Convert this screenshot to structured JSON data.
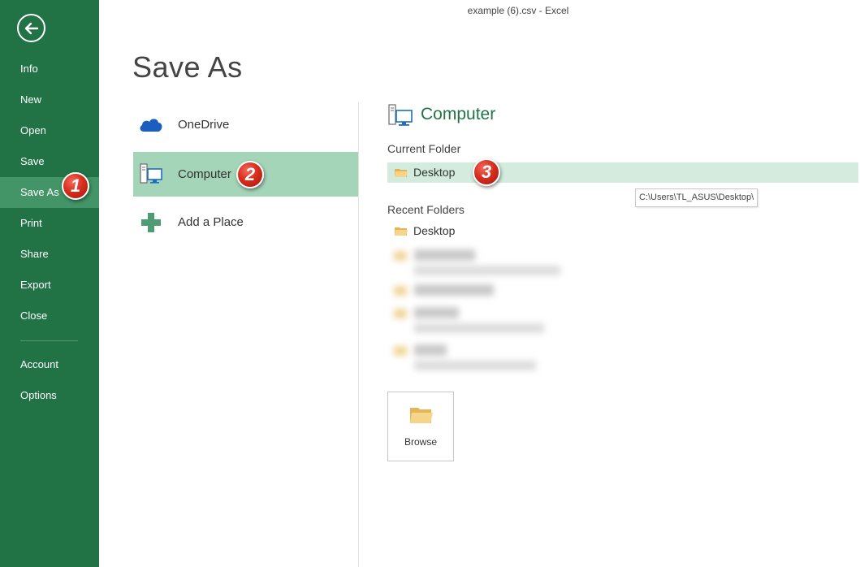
{
  "window": {
    "title": "example (6).csv - Excel"
  },
  "backstage": {
    "items": [
      {
        "label": "Info"
      },
      {
        "label": "New"
      },
      {
        "label": "Open"
      },
      {
        "label": "Save"
      },
      {
        "label": "Save As"
      },
      {
        "label": "Print"
      },
      {
        "label": "Share"
      },
      {
        "label": "Export"
      },
      {
        "label": "Close"
      },
      {
        "label": "Account"
      },
      {
        "label": "Options"
      }
    ],
    "active": "Save As",
    "accent": "#217346"
  },
  "page": {
    "title": "Save As"
  },
  "places": [
    {
      "label": "OneDrive",
      "icon": "cloud-icon"
    },
    {
      "label": "Computer",
      "icon": "computer-icon"
    },
    {
      "label": "Add a Place",
      "icon": "plus-icon"
    }
  ],
  "detail": {
    "title": "Computer",
    "current_folder_label": "Current Folder",
    "current_folder": "Desktop",
    "tooltip": "C:\\Users\\TL_ASUS\\Desktop\\",
    "recent_folders_label": "Recent Folders",
    "recent_folder": "Desktop",
    "browse_label": "Browse"
  },
  "badges": [
    "1",
    "2",
    "3"
  ]
}
